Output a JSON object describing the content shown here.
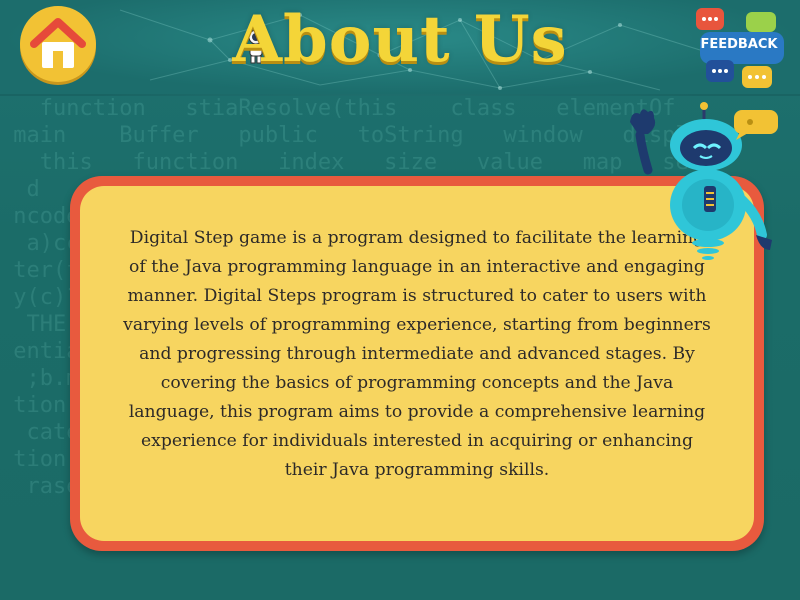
{
  "header": {
    "title": "About Us",
    "home_icon": "home-icon",
    "feedback_label": "FEEDBACK"
  },
  "main": {
    "description": "Digital Step game is a program designed to facilitate the learning of the Java programming language in an interactive and engaging manner. Digital Steps program is structured to cater to users with varying levels of programming experience, starting from beginners and progressing through intermediate and advanced stages. By covering the basics of programming concepts and the Java language, this program aims to provide a comprehensive learning experience for individuals interested in acquiring or enhancing their Java programming skills."
  },
  "colors": {
    "title": "#f4d538",
    "card_border": "#e85a3e",
    "card_fill": "#f7d560",
    "background": "#1f6f6c",
    "home_button": "#f2c234",
    "home_roof": "#e64a3a"
  }
}
